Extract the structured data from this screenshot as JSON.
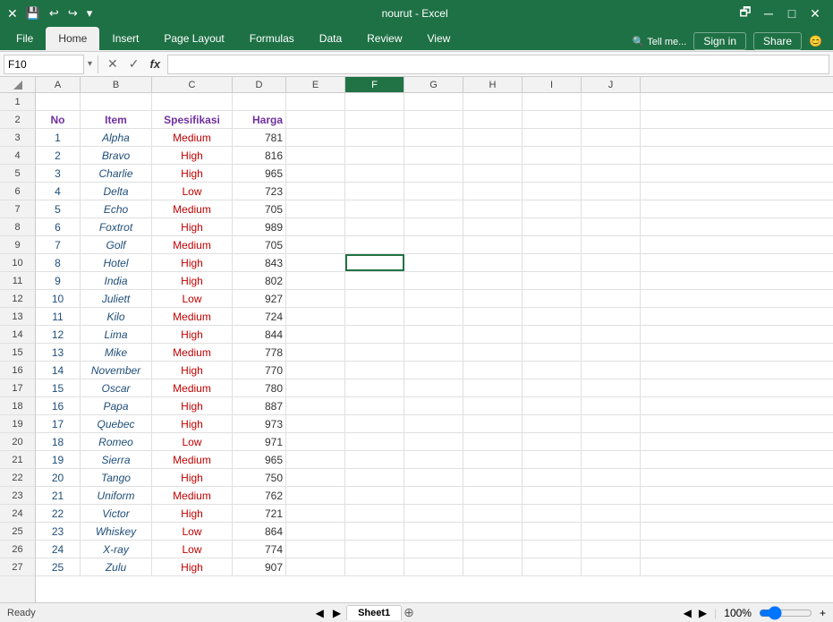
{
  "titleBar": {
    "title": "nourut - Excel",
    "quickAccess": [
      "💾",
      "↩",
      "↪",
      "▾"
    ]
  },
  "ribbon": {
    "tabs": [
      "File",
      "Home",
      "Insert",
      "Page Layout",
      "Formulas",
      "Data",
      "Review",
      "View"
    ],
    "activeTab": "Home",
    "tellMe": "Tell me...",
    "signIn": "Sign in",
    "share": "Share"
  },
  "formulaBar": {
    "nameBox": "F10",
    "formula": ""
  },
  "columns": {
    "headers": [
      "A",
      "B",
      "C",
      "D",
      "E",
      "F",
      "G",
      "H",
      "I",
      "J"
    ],
    "widths": [
      50,
      80,
      90,
      60,
      66,
      66,
      66,
      66,
      66,
      66
    ]
  },
  "rows": [
    {
      "num": 1,
      "cells": [
        "",
        "",
        "",
        "",
        "",
        "",
        "",
        "",
        "",
        ""
      ]
    },
    {
      "num": 2,
      "cells": [
        "No",
        "Item",
        "Spesifikasi",
        "Harga",
        "",
        "",
        "",
        "",
        "",
        ""
      ]
    },
    {
      "num": 3,
      "cells": [
        "1",
        "Alpha",
        "Medium",
        "781",
        "",
        "",
        "",
        "",
        "",
        ""
      ]
    },
    {
      "num": 4,
      "cells": [
        "2",
        "Bravo",
        "High",
        "816",
        "",
        "",
        "",
        "",
        "",
        ""
      ]
    },
    {
      "num": 5,
      "cells": [
        "3",
        "Charlie",
        "High",
        "965",
        "",
        "",
        "",
        "",
        "",
        ""
      ]
    },
    {
      "num": 6,
      "cells": [
        "4",
        "Delta",
        "Low",
        "723",
        "",
        "",
        "",
        "",
        "",
        ""
      ]
    },
    {
      "num": 7,
      "cells": [
        "5",
        "Echo",
        "Medium",
        "705",
        "",
        "",
        "",
        "",
        "",
        ""
      ]
    },
    {
      "num": 8,
      "cells": [
        "6",
        "Foxtrot",
        "High",
        "989",
        "",
        "",
        "",
        "",
        "",
        ""
      ]
    },
    {
      "num": 9,
      "cells": [
        "7",
        "Golf",
        "Medium",
        "705",
        "",
        "",
        "",
        "",
        "",
        ""
      ]
    },
    {
      "num": 10,
      "cells": [
        "8",
        "Hotel",
        "High",
        "843",
        "",
        "",
        "",
        "",
        "",
        ""
      ]
    },
    {
      "num": 11,
      "cells": [
        "9",
        "India",
        "High",
        "802",
        "",
        "",
        "",
        "",
        "",
        ""
      ]
    },
    {
      "num": 12,
      "cells": [
        "10",
        "Juliett",
        "Low",
        "927",
        "",
        "",
        "",
        "",
        "",
        ""
      ]
    },
    {
      "num": 13,
      "cells": [
        "11",
        "Kilo",
        "Medium",
        "724",
        "",
        "",
        "",
        "",
        "",
        ""
      ]
    },
    {
      "num": 14,
      "cells": [
        "12",
        "Lima",
        "High",
        "844",
        "",
        "",
        "",
        "",
        "",
        ""
      ]
    },
    {
      "num": 15,
      "cells": [
        "13",
        "Mike",
        "Medium",
        "778",
        "",
        "",
        "",
        "",
        "",
        ""
      ]
    },
    {
      "num": 16,
      "cells": [
        "14",
        "November",
        "High",
        "770",
        "",
        "",
        "",
        "",
        "",
        ""
      ]
    },
    {
      "num": 17,
      "cells": [
        "15",
        "Oscar",
        "Medium",
        "780",
        "",
        "",
        "",
        "",
        "",
        ""
      ]
    },
    {
      "num": 18,
      "cells": [
        "16",
        "Papa",
        "High",
        "887",
        "",
        "",
        "",
        "",
        "",
        ""
      ]
    },
    {
      "num": 19,
      "cells": [
        "17",
        "Quebec",
        "High",
        "973",
        "",
        "",
        "",
        "",
        "",
        ""
      ]
    },
    {
      "num": 20,
      "cells": [
        "18",
        "Romeo",
        "Low",
        "971",
        "",
        "",
        "",
        "",
        "",
        ""
      ]
    },
    {
      "num": 21,
      "cells": [
        "19",
        "Sierra",
        "Medium",
        "965",
        "",
        "",
        "",
        "",
        "",
        ""
      ]
    },
    {
      "num": 22,
      "cells": [
        "20",
        "Tango",
        "High",
        "750",
        "",
        "",
        "",
        "",
        "",
        ""
      ]
    },
    {
      "num": 23,
      "cells": [
        "21",
        "Uniform",
        "Medium",
        "762",
        "",
        "",
        "",
        "",
        "",
        ""
      ]
    },
    {
      "num": 24,
      "cells": [
        "22",
        "Victor",
        "High",
        "721",
        "",
        "",
        "",
        "",
        "",
        ""
      ]
    },
    {
      "num": 25,
      "cells": [
        "23",
        "Whiskey",
        "Low",
        "864",
        "",
        "",
        "",
        "",
        "",
        ""
      ]
    },
    {
      "num": 26,
      "cells": [
        "24",
        "X-ray",
        "Low",
        "774",
        "",
        "",
        "",
        "",
        "",
        ""
      ]
    },
    {
      "num": 27,
      "cells": [
        "25",
        "Zulu",
        "High",
        "907",
        "",
        "",
        "",
        "",
        "",
        ""
      ]
    }
  ],
  "selectedCell": {
    "row": 10,
    "col": "F"
  },
  "sheetTabs": [
    "Sheet1"
  ],
  "statusBar": {
    "ready": "Ready"
  }
}
